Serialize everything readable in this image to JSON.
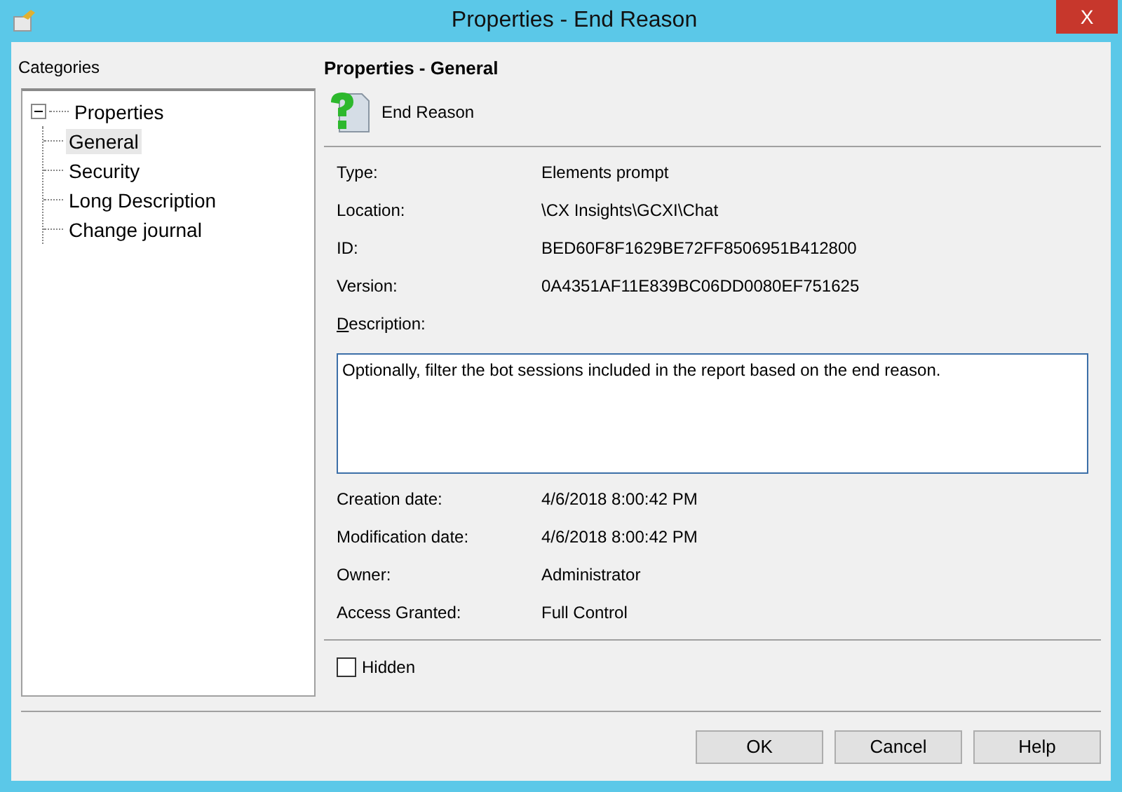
{
  "window": {
    "title": "Properties - End Reason",
    "close": "X"
  },
  "categories": {
    "label": "Categories",
    "tree": [
      {
        "label": "Properties",
        "expanded": true,
        "selected": false,
        "children": [
          {
            "label": "General",
            "selected": true
          },
          {
            "label": "Security",
            "selected": false
          },
          {
            "label": "Long Description",
            "selected": false
          },
          {
            "label": "Change journal",
            "selected": false
          }
        ]
      }
    ]
  },
  "panel": {
    "heading": "Properties - General",
    "object_name": "End Reason",
    "fields": [
      {
        "label": "Type:",
        "value": "Elements prompt"
      },
      {
        "label": "Location:",
        "value": "\\CX Insights\\GCXI\\Chat"
      },
      {
        "label": "ID:",
        "value": "BED60F8F1629BE72FF8506951B412800"
      },
      {
        "label": "Version:",
        "value": "0A4351AF11E839BC06DD0080EF751625"
      }
    ],
    "description": {
      "label": "Description:",
      "value": "Optionally, filter the bot sessions included in the report based on the end reason."
    },
    "fields_after": [
      {
        "label": "Creation date:",
        "value": "4/6/2018 8:00:42 PM"
      },
      {
        "label": "Modification date:",
        "value": "4/6/2018 8:00:42 PM"
      },
      {
        "label": "Owner:",
        "value": "Administrator"
      },
      {
        "label": "Access Granted:",
        "value": "Full Control"
      }
    ],
    "hidden": {
      "label": "Hidden",
      "checked": false
    }
  },
  "buttons": [
    "OK",
    "Cancel",
    "Help"
  ]
}
